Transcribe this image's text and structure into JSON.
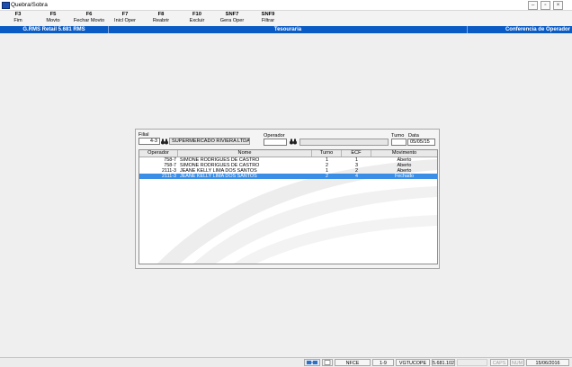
{
  "window": {
    "title": "Quebra/Sobra"
  },
  "toolbar": [
    {
      "key": "F3",
      "label": "Fim"
    },
    {
      "key": "F5",
      "label": "Movto"
    },
    {
      "key": "F6",
      "label": "Fechar Movto"
    },
    {
      "key": "F7",
      "label": "Inicl Oper"
    },
    {
      "key": "F8",
      "label": "Reabrir"
    },
    {
      "key": "F10",
      "label": "Excluir"
    },
    {
      "key": "SNF7",
      "label": "Gera Oper"
    },
    {
      "key": "SNF9",
      "label": "Filtrar"
    }
  ],
  "infobar": {
    "system": "G.RMS Retail 5.681 RMS",
    "module": "Tesouraria",
    "screen": "Conferencia de Operador"
  },
  "form": {
    "filial_label": "Filial",
    "filial_code": "4-3",
    "filial_name": "SUPERMERCADO RIVIERA LTDA",
    "operador_label": "Operador",
    "operador_value": "",
    "operador_name": "",
    "turno_label": "Turno",
    "turno_value": "",
    "data_label": "Data",
    "data_value": "05/05/15"
  },
  "grid": {
    "columns": [
      "Operador",
      "Nome",
      "Turno",
      "ECF",
      "Movimento"
    ],
    "rows": [
      {
        "operador": "758-7",
        "nome": "SIMONE RODRIGUES DE CASTRO",
        "turno": "1",
        "ecf": "1",
        "movimento": "Aberto"
      },
      {
        "operador": "758-7",
        "nome": "SIMONE RODRIGUES DE CASTRO",
        "turno": "2",
        "ecf": "3",
        "movimento": "Aberto"
      },
      {
        "operador": "2111-3",
        "nome": "JEANE KELLY LIMA DOS SANTOS",
        "turno": "1",
        "ecf": "2",
        "movimento": "Aberto"
      },
      {
        "operador": "2111-3",
        "nome": "JEANE KELLY LIMA DOS SANTOS",
        "turno": "2",
        "ecf": "4",
        "movimento": "Fechado"
      }
    ]
  },
  "statusbar": {
    "nfce": "NFCE",
    "page": "1-9",
    "user": "VGTUCOPE",
    "version": "5.681.1025",
    "caps": "CAPS",
    "num": "NUM",
    "date": "15/06/2016"
  },
  "colors": {
    "infobar": "#0a5bc4",
    "selection": "#3a8ee6"
  }
}
